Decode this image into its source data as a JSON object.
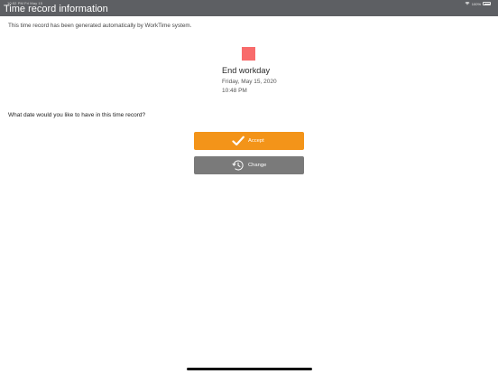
{
  "status_bar": {
    "time_date": "10:52 PM   Fri May 15",
    "battery": "100%",
    "icons": [
      "wifi-icon",
      "battery-icon"
    ]
  },
  "header": {
    "title": "Time record information"
  },
  "info": {
    "text": "This time record has been generated automatically by WorkTime system."
  },
  "record": {
    "title": "End workday",
    "date": "Friday, May 15, 2020",
    "time": "10:48 PM",
    "icon_color": "#f86b6b"
  },
  "question": {
    "text": "What date would you like to have in this time record?"
  },
  "actions": {
    "accept_label": "Accept",
    "change_label": "Change",
    "accept_color": "#f39419",
    "change_color": "#7a7a7a"
  }
}
